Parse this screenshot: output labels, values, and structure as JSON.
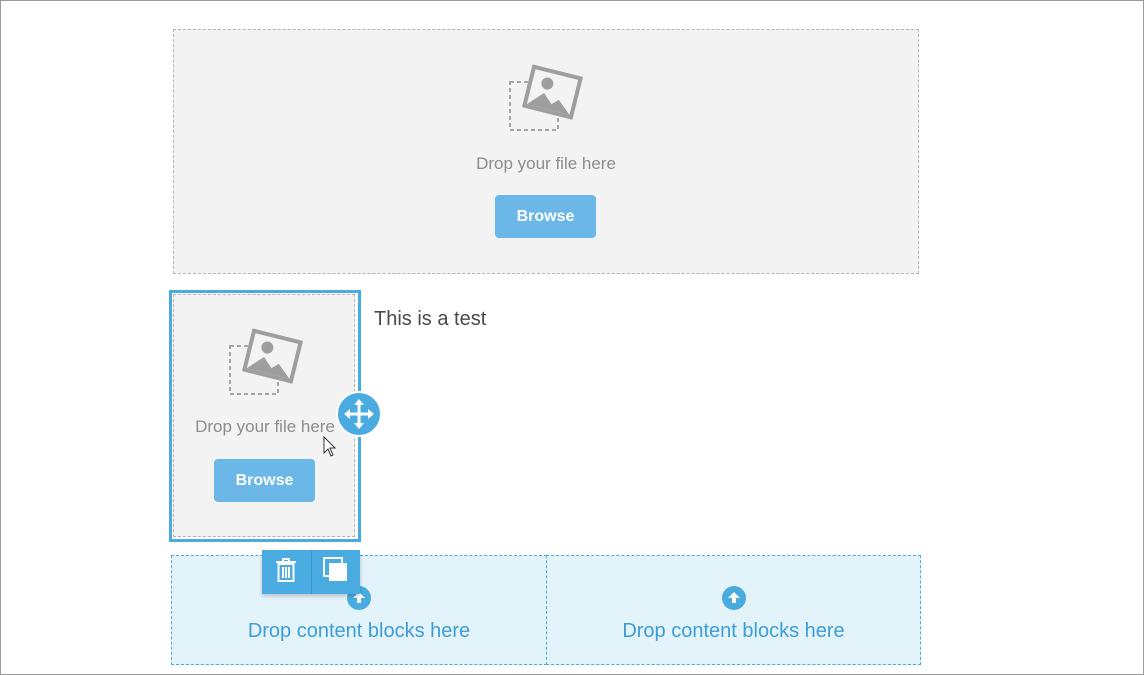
{
  "top_block": {
    "drop_text": "Drop your file here",
    "browse_label": "Browse"
  },
  "selected_block": {
    "drop_text": "Drop your file here",
    "browse_label": "Browse"
  },
  "text_block": {
    "content": "This is a test"
  },
  "drop_zones": [
    {
      "label": "Drop content blocks here"
    },
    {
      "label": "Drop content blocks here"
    }
  ],
  "toolbar": {
    "items": [
      {
        "icon": "trash-icon"
      },
      {
        "icon": "duplicate-icon"
      }
    ]
  },
  "colors": {
    "accent": "#4aabe0",
    "button": "#6bb8e8",
    "placeholder_bg": "#f3f3f3",
    "dropzone_bg": "#e3f3fa",
    "muted_text": "#8c8c8c"
  }
}
